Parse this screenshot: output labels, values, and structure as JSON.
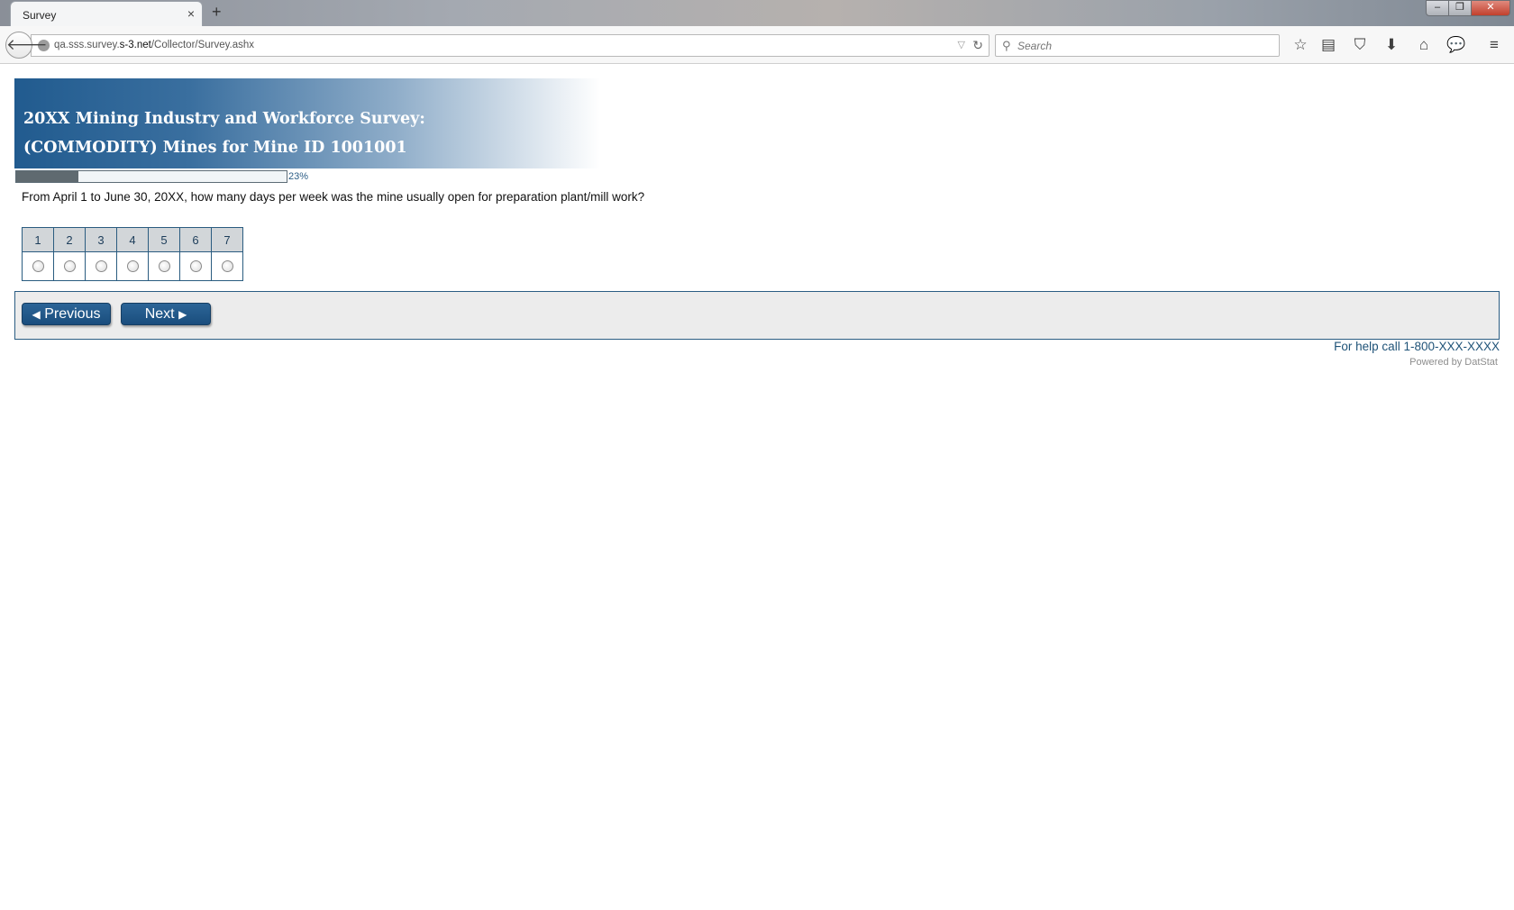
{
  "browser": {
    "tab_title": "Survey",
    "tab_close": "×",
    "new_tab": "+",
    "url_host_pre": "qa.sss.survey.",
    "url_host_main": "s-3.net",
    "url_path": "/Collector/Survey.ashx",
    "search_placeholder": "Search",
    "window_buttons": {
      "minimize": "‒",
      "restore": "❐",
      "close": "✕"
    },
    "icons": [
      "star-icon",
      "reading-list-icon",
      "pocket-icon",
      "download-icon",
      "home-icon",
      "chat-icon",
      "menu-icon"
    ]
  },
  "survey": {
    "title_line1": "20XX Mining Industry and Workforce Survey:",
    "title_line2": "(COMMODITY) Mines for Mine ID 1001001",
    "progress_percent": 23,
    "progress_label": "23%",
    "question": "From April 1 to June 30, 20XX, how many days per week was the mine usually open for preparation plant/mill work?",
    "options": [
      "1",
      "2",
      "3",
      "4",
      "5",
      "6",
      "7"
    ],
    "previous_label": "Previous",
    "next_label": "Next",
    "help_text": "For help call 1-800-XXX-XXXX",
    "powered_by": "Powered by DatStat"
  },
  "colors": {
    "banner_dark": "#215b8f",
    "button": "#1f5686",
    "border": "#2b5d83",
    "progress_fill": "#5f6a70"
  }
}
